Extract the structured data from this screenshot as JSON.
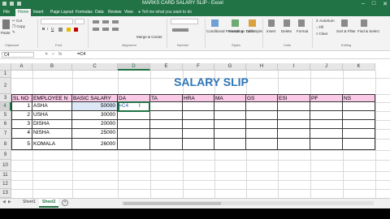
{
  "window": {
    "title": "MARKS CARD SALARY SLIP - Excel"
  },
  "tabs": [
    "File",
    "Home",
    "Insert",
    "Page Layout",
    "Formulas",
    "Data",
    "Review",
    "View",
    "Help"
  ],
  "tell_me": "Tell me what you want to do",
  "ribbon": {
    "clipboard": {
      "label": "Clipboard",
      "paste": "Paste",
      "cut": "Cut",
      "copy": "Copy",
      "format_painter": "Format Painter"
    },
    "font_group": "Font",
    "alignment_group": "Alignment",
    "number_group": "Number",
    "merge_center": "Merge & Center",
    "styles_group": "Styles",
    "conditional_formatting": "Conditional Formatting",
    "format_as_table": "Format as Table",
    "cell_styles": "Cell Styles",
    "cells_group": "Cells",
    "insert": "Insert",
    "delete": "Delete",
    "format": "Format",
    "editing_group": "Editing",
    "autosum": "AutoSum",
    "fill": "Fill",
    "clear": "Clear",
    "sort_filter": "Sort & Filter",
    "find_select": "Find & Select"
  },
  "formula_bar": {
    "name_box": "C4",
    "formula": "=C4"
  },
  "columns": [
    "A",
    "B",
    "C",
    "D",
    "E",
    "F",
    "G",
    "H",
    "I",
    "J",
    "K"
  ],
  "rows": [
    "1",
    "2",
    "3",
    "4",
    "5",
    "6",
    "7",
    "8",
    "9",
    "10",
    "11",
    "12",
    "13"
  ],
  "sheet": {
    "title": "SALARY SLIP",
    "headers": [
      "SL NO",
      "EMPLOYEE N",
      "BASIC SALARY",
      "DA",
      "TA",
      "HRA",
      "MA",
      "GS",
      "ESI",
      "PF",
      "NS"
    ],
    "editing_text": "=C4",
    "data_rows": [
      {
        "sl": "1",
        "name": "ASHA",
        "basic": "50000"
      },
      {
        "sl": "2",
        "name": "USHA",
        "basic": "30000"
      },
      {
        "sl": "3",
        "name": "DISHA",
        "basic": "20000"
      },
      {
        "sl": "4",
        "name": "NISHA",
        "basic": "25000"
      },
      {
        "sl": "5",
        "name": "KOMALA",
        "basic": "26000"
      }
    ]
  },
  "sheet_tabs": [
    "Sheet1",
    "Sheet2"
  ],
  "active_sheet": "Sheet2",
  "theme": {
    "accent": "#217346",
    "header_fill": "#f9c9e6",
    "title_color": "#2e75b6",
    "selection_fill": "#dde8f7"
  }
}
